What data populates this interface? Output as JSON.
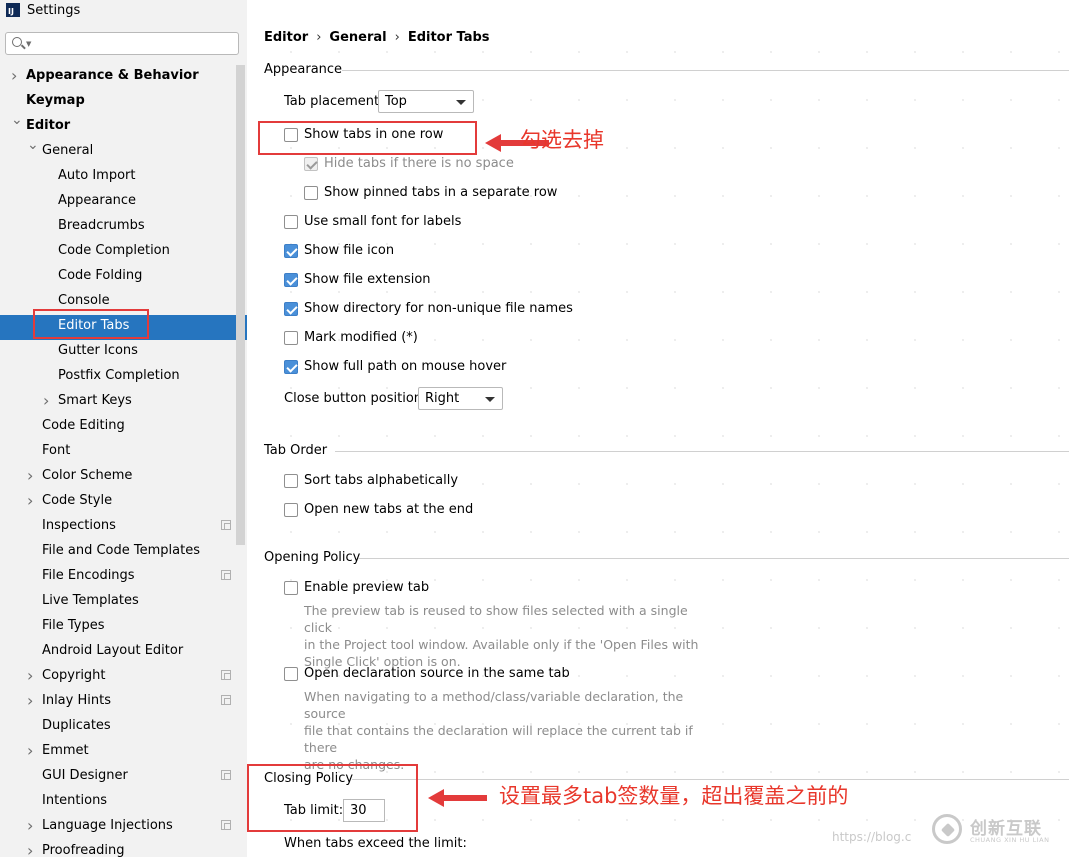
{
  "window": {
    "title": "Settings",
    "app_icon_text": "IJ"
  },
  "sidebar": {
    "search_placeholder": "",
    "items": [
      {
        "label": "Appearance & Behavior",
        "level": 0,
        "bold": true,
        "arrow": "right"
      },
      {
        "label": "Keymap",
        "level": 0,
        "bold": true,
        "arrow": ""
      },
      {
        "label": "Editor",
        "level": 0,
        "bold": true,
        "arrow": "down"
      },
      {
        "label": "General",
        "level": 1,
        "bold": false,
        "arrow": "down"
      },
      {
        "label": "Auto Import",
        "level": 2
      },
      {
        "label": "Appearance",
        "level": 2
      },
      {
        "label": "Breadcrumbs",
        "level": 2
      },
      {
        "label": "Code Completion",
        "level": 2
      },
      {
        "label": "Code Folding",
        "level": 2
      },
      {
        "label": "Console",
        "level": 2
      },
      {
        "label": "Editor Tabs",
        "level": 2,
        "selected": true
      },
      {
        "label": "Gutter Icons",
        "level": 2
      },
      {
        "label": "Postfix Completion",
        "level": 2
      },
      {
        "label": "Smart Keys",
        "level": 2,
        "arrow": "right"
      },
      {
        "label": "Code Editing",
        "level": 1
      },
      {
        "label": "Font",
        "level": 1
      },
      {
        "label": "Color Scheme",
        "level": 1,
        "arrow": "right"
      },
      {
        "label": "Code Style",
        "level": 1,
        "arrow": "right"
      },
      {
        "label": "Inspections",
        "level": 1,
        "copy_icon": true
      },
      {
        "label": "File and Code Templates",
        "level": 1
      },
      {
        "label": "File Encodings",
        "level": 1,
        "copy_icon": true
      },
      {
        "label": "Live Templates",
        "level": 1
      },
      {
        "label": "File Types",
        "level": 1
      },
      {
        "label": "Android Layout Editor",
        "level": 1
      },
      {
        "label": "Copyright",
        "level": 1,
        "arrow": "right",
        "copy_icon": true
      },
      {
        "label": "Inlay Hints",
        "level": 1,
        "arrow": "right",
        "copy_icon": true
      },
      {
        "label": "Duplicates",
        "level": 1
      },
      {
        "label": "Emmet",
        "level": 1,
        "arrow": "right"
      },
      {
        "label": "GUI Designer",
        "level": 1,
        "copy_icon": true
      },
      {
        "label": "Intentions",
        "level": 1
      },
      {
        "label": "Language Injections",
        "level": 1,
        "arrow": "right",
        "copy_icon": true
      },
      {
        "label": "Proofreading",
        "level": 1,
        "arrow": "right"
      }
    ]
  },
  "breadcrumb": {
    "part1": "Editor",
    "part2": "General",
    "part3": "Editor Tabs",
    "sep": "›"
  },
  "appearance": {
    "title": "Appearance",
    "tab_placement_label": "Tab placement:",
    "tab_placement_value": "Top",
    "show_tabs_one_row": "Show tabs in one row",
    "hide_tabs_no_space": "Hide tabs if there is no space",
    "show_pinned_separate": "Show pinned tabs in a separate row",
    "small_font": "Use small font for labels",
    "show_file_icon": "Show file icon",
    "show_file_extension": "Show file extension",
    "show_directory": "Show directory for non-unique file names",
    "mark_modified": "Mark modified (*)",
    "full_path_hover": "Show full path on mouse hover",
    "close_button_label": "Close button position:",
    "close_button_value": "Right"
  },
  "tab_order": {
    "title": "Tab Order",
    "sort_alpha": "Sort tabs alphabetically",
    "open_new_end": "Open new tabs at the end"
  },
  "opening_policy": {
    "title": "Opening Policy",
    "enable_preview": "Enable preview tab",
    "preview_desc1": "The preview tab is reused to show files selected with a single click",
    "preview_desc2": "in the Project tool window. Available only if the 'Open Files with",
    "preview_desc3": "Single Click' option is on.",
    "open_declaration": "Open declaration source in the same tab",
    "decl_desc1": "When navigating to a method/class/variable declaration, the source",
    "decl_desc2": "file that contains the declaration will replace the current tab if there",
    "decl_desc3": "are no changes."
  },
  "closing_policy": {
    "title": "Closing Policy",
    "tab_limit_label": "Tab limit:",
    "tab_limit_value": "30",
    "exceed_label": "When tabs exceed the limit:"
  },
  "annotations": {
    "note1": "勾选去掉",
    "note2": "设置最多tab签数量，超出覆盖之前的",
    "color": "#e33b3b"
  },
  "watermark": {
    "url_text": "https://blog.c",
    "brand_name": "创新互联",
    "brand_sub": "CHUANG XIN HU LIAN"
  },
  "colors": {
    "selection": "#2675bf",
    "checkbox_checked": "#4a90d9",
    "sidebar_bg": "#f2f2f2"
  }
}
